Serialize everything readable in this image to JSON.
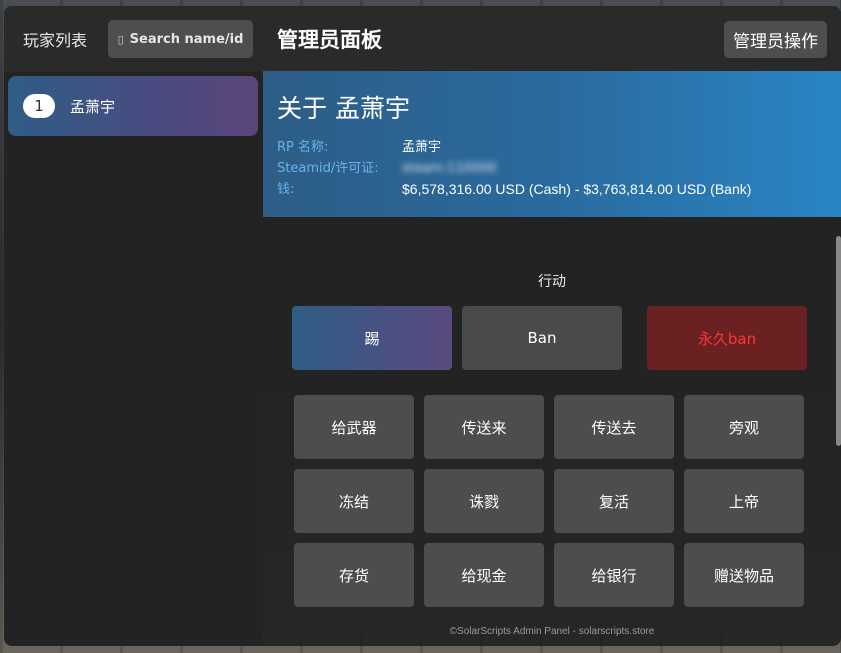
{
  "sidebar": {
    "title": "玩家列表",
    "search_placeholder": "Search name/id",
    "players": [
      {
        "id": "1",
        "name": "孟萧宇"
      }
    ]
  },
  "header": {
    "title": "管理员面板",
    "admin_actions_label": "管理员操作"
  },
  "player_info": {
    "title": "关于 孟萧宇",
    "rp_name_label": "RP 名称:",
    "rp_name_value": "孟萧宇",
    "steamid_label": "Steamid/许可证:",
    "steamid_value": "steam:110000",
    "money_label": "钱:",
    "money_value": "$6,578,316.00 USD (Cash) - $3,763,814.00 USD (Bank)"
  },
  "actions": {
    "heading": "行动",
    "kick_label": "踢",
    "ban_label": "Ban",
    "permban_label": "永久ban",
    "grid": [
      "给武器",
      "传送来",
      "传送去",
      "旁观",
      "冻结",
      "诛戮",
      "复活",
      "上帝",
      "存货",
      "给现金",
      "给银行",
      "赠送物品"
    ]
  },
  "footer": "©SolarScripts Admin Panel - solarscripts.store",
  "colors": {
    "accent_blue": "#2a85c4",
    "permban_red": "#ff3535"
  }
}
